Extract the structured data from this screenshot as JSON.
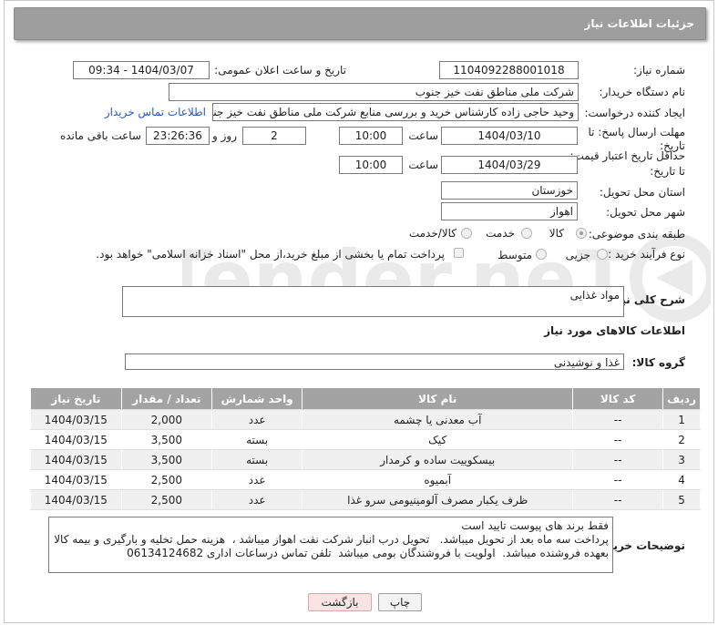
{
  "header": {
    "title": "جزئیات اطلاعات نیاز"
  },
  "fields": {
    "need_number_label": "شماره نیاز:",
    "need_number": "1104092288001018",
    "announce_label": "تاریخ و ساعت اعلان عمومی:",
    "announce_value": "1404/03/07 - 09:34",
    "buyer_label": "نام دستگاه خریدار:",
    "buyer_value": "شرکت ملی مناطق نفت خیز جنوب",
    "creator_label": "ایجاد کننده درخواست:",
    "creator_value": "وحید حاجی زاده  کارشناس خرید و بررسی منابع  شرکت ملی مناطق نفت خیز جنوب",
    "contact_link": "اطلاعات تماس خریدار",
    "deadline_label_1": "مهلت ارسال پاسخ: تا",
    "deadline_label_2": "تاریخ:",
    "deadline_date": "1404/03/10",
    "time_label": "ساعت",
    "deadline_time": "10:00",
    "days_value": "2",
    "days_label": "روز و",
    "remaining_value": "23:26:36",
    "remaining_label": "ساعت باقی مانده",
    "validity_label_1": "حداقل تاریخ اعتبار قیمت:",
    "validity_label_2": "تا تاریخ:",
    "validity_date": "1404/03/29",
    "validity_time": "10:00",
    "province_label": "استان محل تحویل:",
    "province_value": "خوزستان",
    "city_label": "شهر محل تحویل:",
    "city_value": "اهواز",
    "category_label": "طبقه بندی موضوعی:",
    "category_options": [
      "کالا",
      "خدمت",
      "کالا/خدمت"
    ],
    "process_label": "نوع فرآیند خرید :",
    "process_options": [
      "جزیی",
      "متوسط"
    ],
    "process_note": "پرداخت تمام یا بخشی از مبلغ خرید،از محل \"اسناد خزانه اسلامی\" خواهد بود."
  },
  "description": {
    "label": "شرح کلی نیاز:",
    "value": "مواد غذایی"
  },
  "goods_section": {
    "title": "اطلاعات کالاهای مورد نیاز",
    "group_label": "گروه کالا:",
    "group_value": "غذا و نوشیدنی"
  },
  "table": {
    "headers": [
      "ردیف",
      "کد کالا",
      "نام کالا",
      "واحد شمارش",
      "تعداد / مقدار",
      "تاریخ نیاز"
    ],
    "rows": [
      [
        "1",
        "--",
        "آب معدنی یا چشمه",
        "عدد",
        "2,000",
        "1404/03/15"
      ],
      [
        "2",
        "--",
        "کیک",
        "بسته",
        "3,500",
        "1404/03/15"
      ],
      [
        "3",
        "--",
        "بیسکوییت ساده و کرمدار",
        "بسته",
        "3,500",
        "1404/03/15"
      ],
      [
        "4",
        "--",
        "آبمیوه",
        "عدد",
        "2,500",
        "1404/03/15"
      ],
      [
        "5",
        "--",
        "ظرف یکبار مصرف آلومینیومی سرو غذا",
        "عدد",
        "2,500",
        "1404/03/15"
      ]
    ]
  },
  "buyer_notes": {
    "label": "توضیحات خریدار:",
    "value": "فقط برند های پیوست تایید است\nپرداخت سه ماه بعد از تحویل میباشد.   تحویل درب انبار شرکت نفت اهواز میباشد ،  هزینه حمل تخلیه و بارگیری و بیمه کالا بعهده فروشنده میباشد.  اولویت با فروشندگان بومی میباشد  تلفن تماس درساعات اداری 06134124682"
  },
  "buttons": {
    "print": "چاپ",
    "back": "بازگشت"
  },
  "watermark": {
    "text": "AriaTender.neT"
  }
}
